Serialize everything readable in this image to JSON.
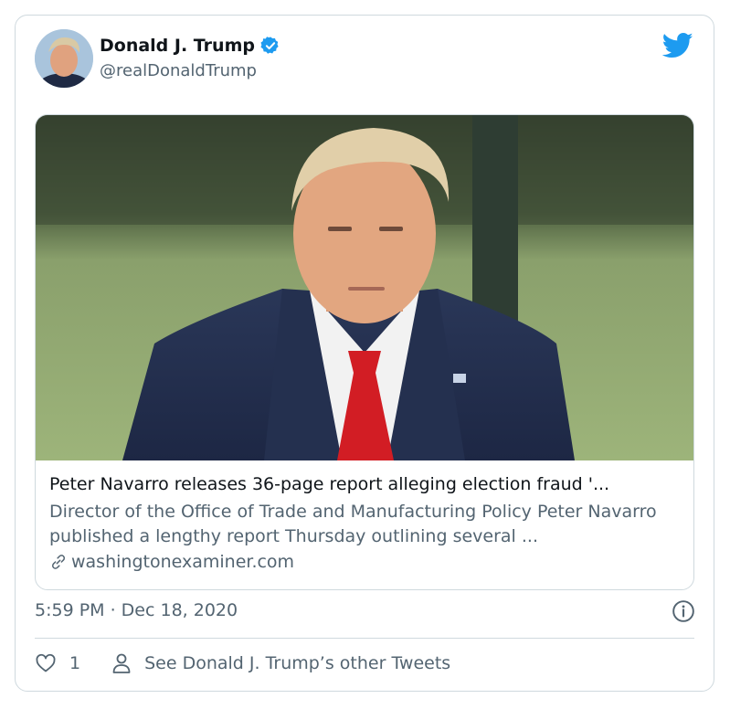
{
  "colors": {
    "text_primary": "#0f1419",
    "text_secondary": "#536471",
    "twitter_blue": "#1d9bf0",
    "border": "#cfd9de"
  },
  "author": {
    "name": "Donald J. Trump",
    "handle": "@realDonaldTrump",
    "verified": true,
    "avatar_icon": "profile-photo"
  },
  "link_card": {
    "title": "Peter Navarro releases 36-page report alleging election fraud '...",
    "description": "Director of the Office of Trade and Manufacturing Policy Peter Navarro published a lengthy report Thursday outlining several ...",
    "domain": "washingtonexaminer.com",
    "domain_icon": "link-icon"
  },
  "timestamp": "5:59 PM · Dec 18, 2020",
  "actions": {
    "like_count": "1",
    "like_icon": "heart-icon",
    "other_tweets_label": "See Donald J. Trump’s other Tweets",
    "other_tweets_icon": "person-icon"
  },
  "icons": {
    "brand": "twitter-bird-icon",
    "info": "info-icon",
    "verified": "verified-badge-icon"
  }
}
